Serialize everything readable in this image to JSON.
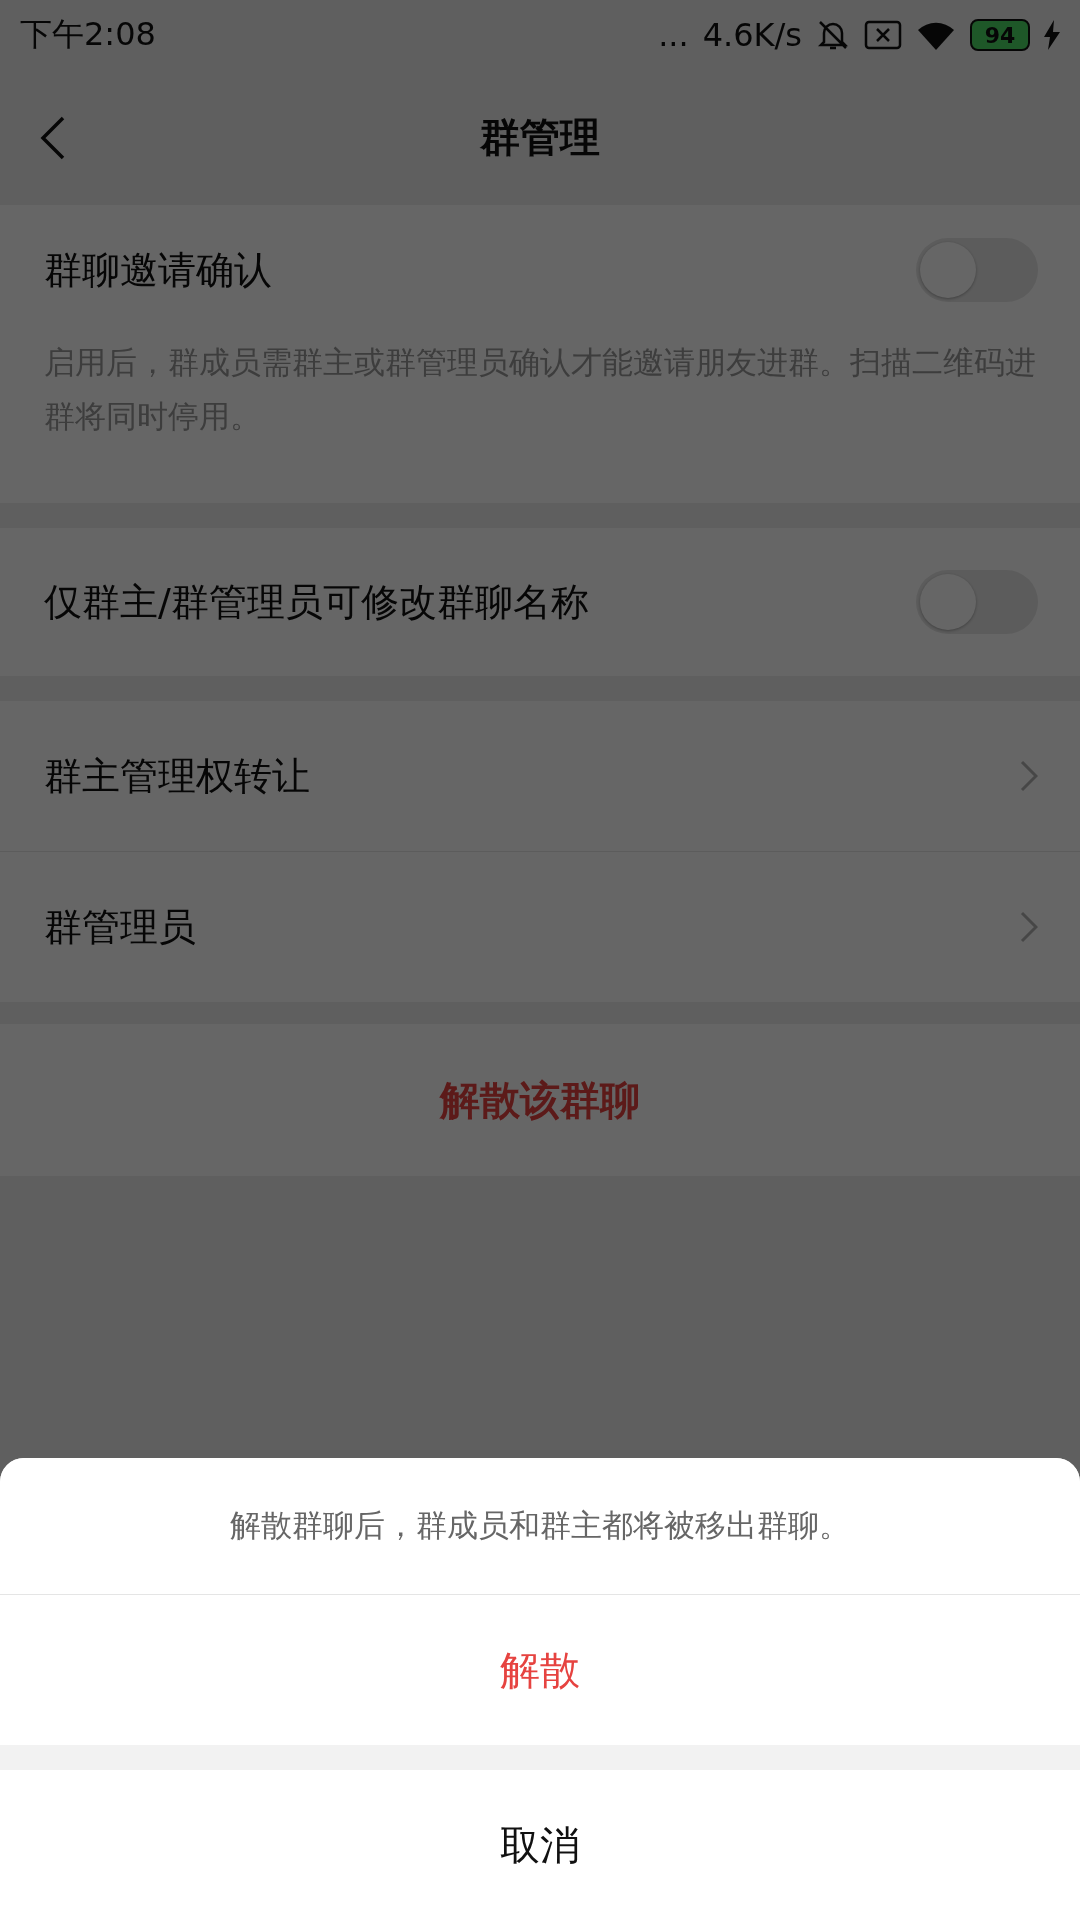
{
  "status_bar": {
    "time": "下午2:08",
    "dots": "...",
    "speed": "4.6K/s",
    "battery": "94"
  },
  "header": {
    "title": "群管理"
  },
  "settings": [
    {
      "kind": "toggle",
      "label": "群聊邀请确认",
      "on": false,
      "description": "启用后，群成员需群主或群管理员确认才能邀请朋友进群。扫描二维码进群将同时停用。"
    },
    {
      "kind": "toggle",
      "label": "仅群主/群管理员可修改群聊名称",
      "on": false
    }
  ],
  "links": [
    {
      "label": "群主管理权转让"
    },
    {
      "label": "群管理员"
    }
  ],
  "dissolve_button": "解散该群聊",
  "sheet": {
    "message": "解散群聊后，群成员和群主都将被移出群聊。",
    "confirm": "解散",
    "cancel": "取消"
  }
}
